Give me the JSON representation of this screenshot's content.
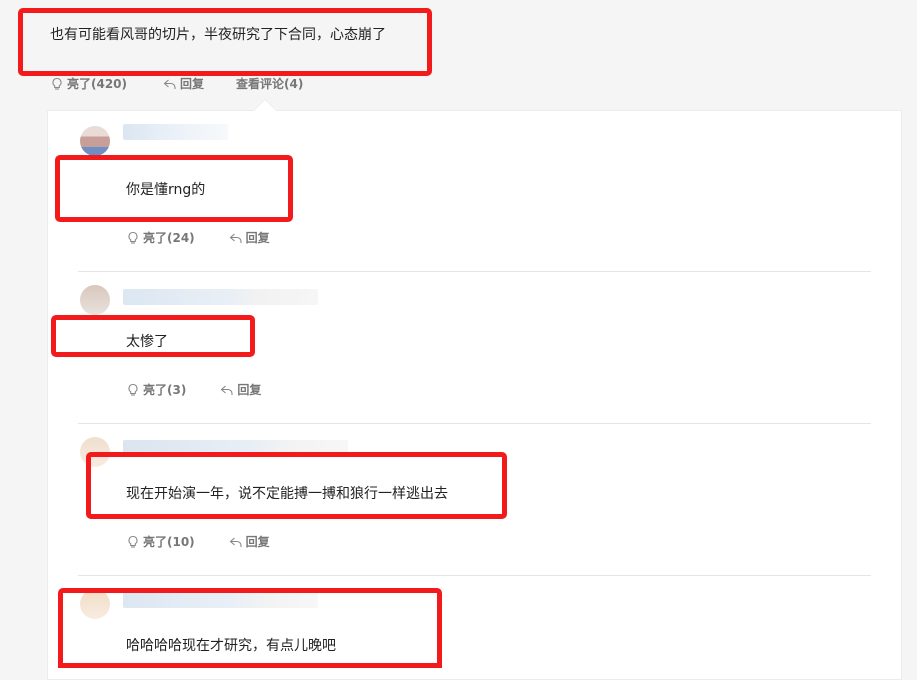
{
  "main_comment": {
    "text": "也有可能看风哥的切片，半夜研究了下合同，心态崩了",
    "like_label": "亮了(420)",
    "reply_label": "回复",
    "view_comments_label": "查看评论(4)"
  },
  "replies": [
    {
      "text": "你是懂rng的",
      "like_label": "亮了(24)",
      "reply_label": "回复"
    },
    {
      "text": "太惨了",
      "like_label": "亮了(3)",
      "reply_label": "回复"
    },
    {
      "text": "现在开始演一年，说不定能搏一搏和狼行一样逃出去",
      "like_label": "亮了(10)",
      "reply_label": "回复"
    },
    {
      "text": "哈哈哈哈现在才研究，有点儿晚吧"
    }
  ],
  "colors": {
    "highlight_box": "#f21a1a",
    "action_text": "#777777",
    "panel_bg": "#ffffff",
    "page_bg": "#f5f5f5"
  },
  "icons": [
    "bulb-icon",
    "reply-arrow-icon"
  ]
}
